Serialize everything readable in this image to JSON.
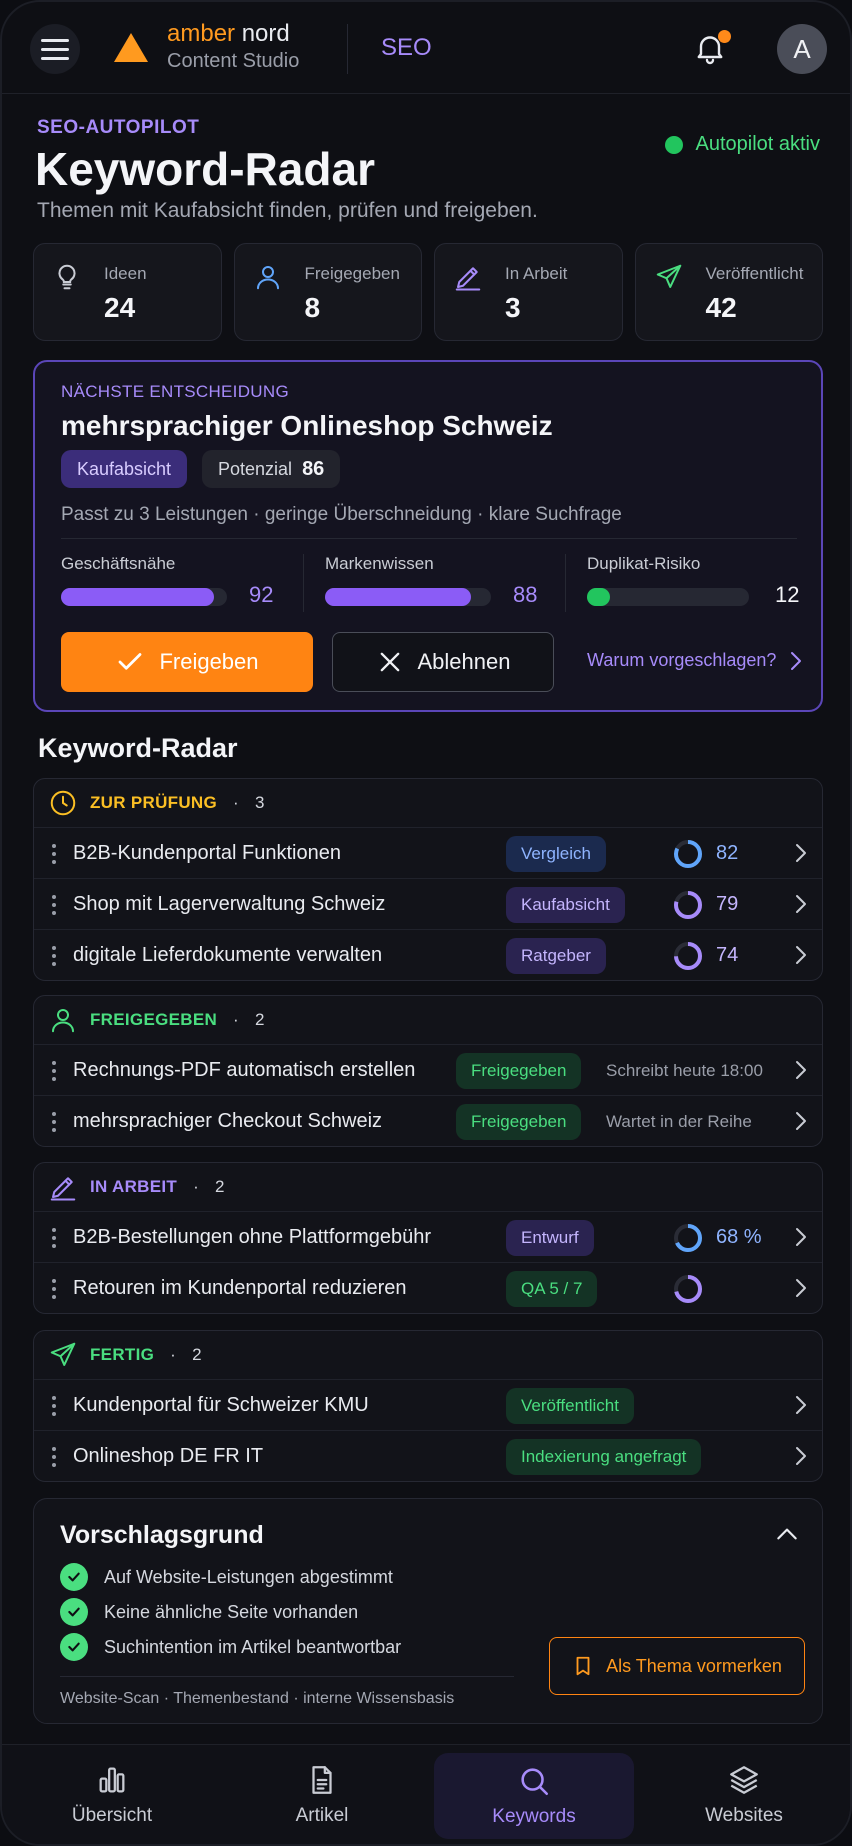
{
  "header": {
    "brand_amber": "amber",
    "brand_nord": "nord",
    "brand_sub": "Content Studio",
    "section": "SEO",
    "avatar_initial": "A"
  },
  "page": {
    "eyebrow": "SEO-AUTOPILOT",
    "title": "Keyword-Radar",
    "subtitle": "Themen mit Kaufabsicht finden, prüfen und freigeben.",
    "autopilot_status": "Autopilot aktiv"
  },
  "stats": [
    {
      "label": "Ideen",
      "value": "24",
      "icon": "lightbulb-icon"
    },
    {
      "label": "Freigegeben",
      "value": "8",
      "icon": "user-icon"
    },
    {
      "label": "In Arbeit",
      "value": "3",
      "icon": "pencil-icon"
    },
    {
      "label": "Veröffentlicht",
      "value": "42",
      "icon": "send-icon"
    }
  ],
  "decision": {
    "eyebrow": "NÄCHSTE ENTSCHEIDUNG",
    "headline": "mehrsprachiger Onlineshop Schweiz",
    "chip_intent": "Kaufabsicht",
    "chip_potential_label": "Potenzial",
    "chip_potential_value": "86",
    "fit_line": "Passt zu 3 Leistungen  ·  geringe Überschneidung  ·  klare Suchfrage",
    "metrics": [
      {
        "label": "Geschäftsnähe",
        "value": "92",
        "fill": 0.92,
        "color": "#8b5cf6"
      },
      {
        "label": "Markenwissen",
        "value": "88",
        "fill": 0.88,
        "color": "#8b5cf6"
      },
      {
        "label": "Duplikat-Risiko",
        "value": "12",
        "fill": 0.12,
        "color": "#22c55e"
      }
    ],
    "approve_label": "Freigeben",
    "reject_label": "Ablehnen",
    "why_label": "Warum vorgeschlagen?"
  },
  "radar": {
    "title": "Keyword-Radar",
    "groups": [
      {
        "label": "ZUR PRÜFUNG",
        "count": "3",
        "color": "#fbbf24",
        "icon": "clock-icon",
        "rows": [
          {
            "title": "B2B-Kundenportal Funktionen",
            "tag": "Vergleich",
            "tag_style": "blue",
            "score": "82",
            "progress": 0.82,
            "ring_color": "#60a5fa"
          },
          {
            "title": "Shop mit Lagerverwaltung Schweiz",
            "tag": "Kaufabsicht",
            "tag_style": "purple",
            "score": "79",
            "progress": 0.79,
            "ring_color": "#a78bfa"
          },
          {
            "title": "digitale Lieferdokumente verwalten",
            "tag": "Ratgeber",
            "tag_style": "purple",
            "score": "74",
            "progress": 0.74,
            "ring_color": "#a78bfa"
          }
        ]
      },
      {
        "label": "FREIGEGEBEN",
        "count": "2",
        "color": "#4ade80",
        "icon": "user-icon",
        "rows": [
          {
            "title": "Rechnungs-PDF automatisch erstellen",
            "tag": "Freigegeben",
            "tag_style": "green",
            "meta": "Schreibt heute 18:00"
          },
          {
            "title": "mehrsprachiger Checkout Schweiz",
            "tag": "Freigegeben",
            "tag_style": "green",
            "meta": "Wartet in der Reihe"
          }
        ]
      },
      {
        "label": "IN ARBEIT",
        "count": "2",
        "color": "#a78bfa",
        "icon": "pencil-icon",
        "rows": [
          {
            "title": "B2B-Bestellungen ohne Plattformgebühr",
            "tag": "Entwurf",
            "tag_style": "purple",
            "score": "68 %",
            "progress": 0.68,
            "ring_color": "#60a5fa"
          },
          {
            "title": "Retouren im Kundenportal reduzieren",
            "tag": "QA  5 / 7",
            "tag_style": "green",
            "progress": 0.71,
            "ring_color": "#a78bfa"
          }
        ]
      },
      {
        "label": "FERTIG",
        "count": "2",
        "color": "#4ade80",
        "icon": "send-icon",
        "rows": [
          {
            "title": "Kundenportal für Schweizer KMU",
            "tag": "Veröffentlicht",
            "tag_style": "green"
          },
          {
            "title": "Onlineshop DE FR IT",
            "tag": "Indexierung angefragt",
            "tag_style": "green"
          }
        ]
      }
    ]
  },
  "reason": {
    "title": "Vorschlagsgrund",
    "items": [
      "Auf Website-Leistungen abgestimmt",
      "Keine ähnliche Seite vorhanden",
      "Suchintention im Artikel beantwortbar"
    ],
    "sources": "Website-Scan  ·  Themenbestand  ·  interne Wissensbasis",
    "save_label": "Als Thema vormerken"
  },
  "nav": [
    {
      "label": "Übersicht",
      "icon": "bar-chart-icon",
      "active": false
    },
    {
      "label": "Artikel",
      "icon": "document-icon",
      "active": false
    },
    {
      "label": "Keywords",
      "icon": "search-icon",
      "active": true
    },
    {
      "label": "Websites",
      "icon": "layers-icon",
      "active": false
    }
  ]
}
